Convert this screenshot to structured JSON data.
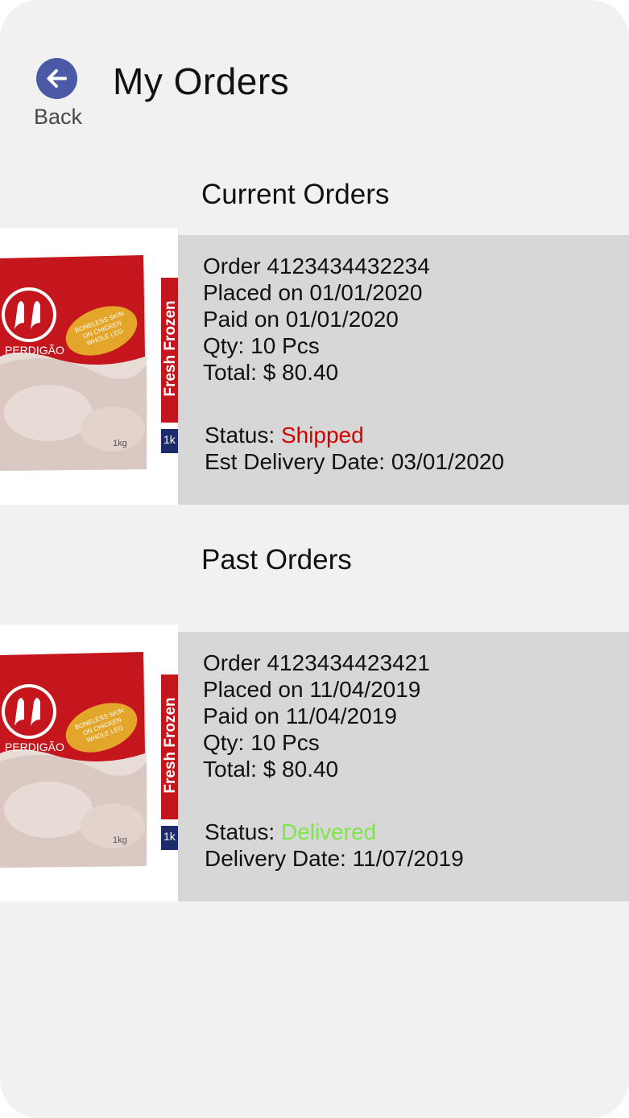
{
  "header": {
    "back_label": "Back",
    "title": "My Orders"
  },
  "sections": {
    "current_title": "Current Orders",
    "past_title": "Past Orders"
  },
  "product": {
    "brand": "PERDIGÃO",
    "badge": "BONELESS SKIN ON CHICKEN WHOLE LEG",
    "side_label": "Fresh Frozen",
    "weight": "1kg",
    "side_tag": "1k"
  },
  "orders": [
    {
      "order_line": "Order 4123434432234",
      "placed_line": "Placed on 01/01/2020",
      "paid_line": "Paid on 01/01/2020",
      "qty_line": "Qty: 10 Pcs",
      "total_line": "Total: $ 80.40",
      "status_label": "Status: ",
      "status_value": "Shipped",
      "status_color": "#d40000",
      "delivery_line": "Est Delivery Date: 03/01/2020"
    },
    {
      "order_line": "Order 4123434423421",
      "placed_line": "Placed on 11/04/2019",
      "paid_line": "Paid on 11/04/2019",
      "qty_line": "Qty: 10 Pcs",
      "total_line": "Total: $ 80.40",
      "status_label": "Status: ",
      "status_value": "Delivered",
      "status_color": "#7ee64a",
      "delivery_line": "Delivery Date: 11/07/2019"
    }
  ],
  "colors": {
    "background": "#f1f1f1",
    "card_panel": "#d7d7d7",
    "back_button": "#4b5aa6",
    "brand_red": "#c4161c"
  },
  "icons": {
    "back": "arrow-left-icon",
    "brand_logo": "bird-logo-icon"
  }
}
